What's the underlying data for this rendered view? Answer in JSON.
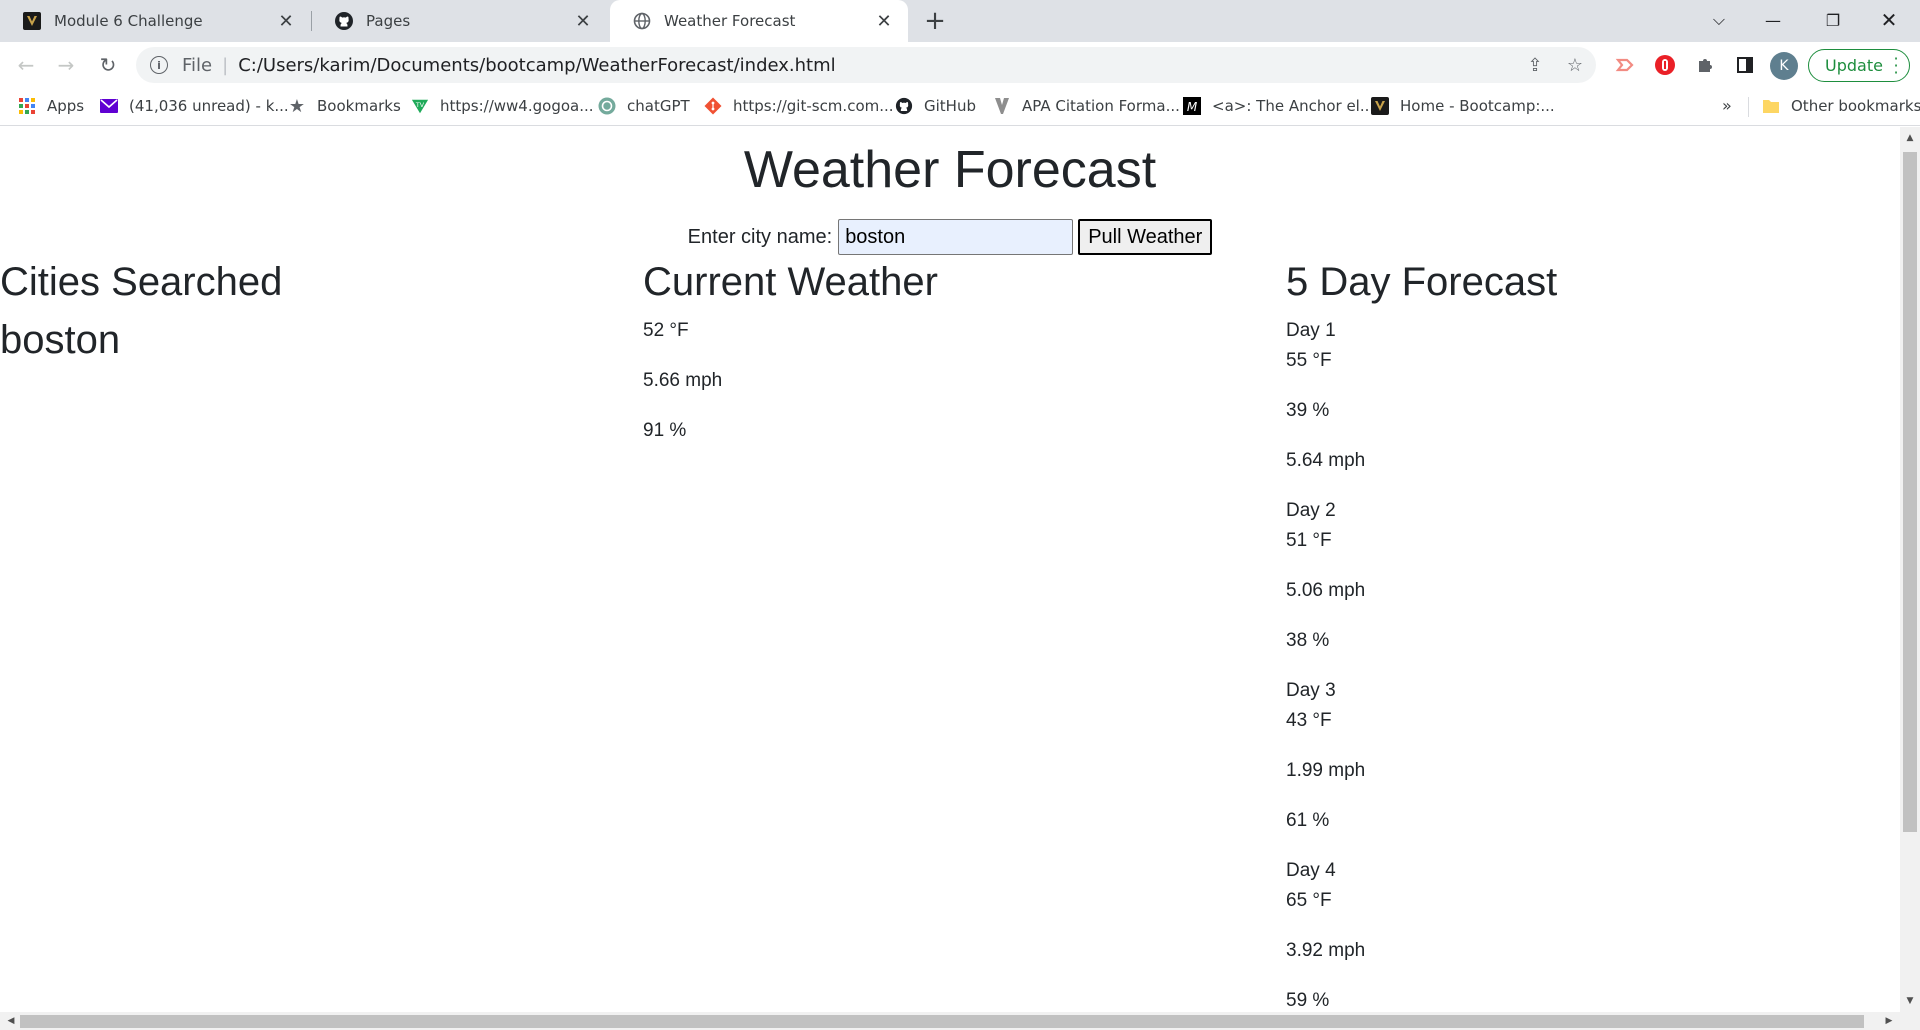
{
  "browser": {
    "tabs": [
      {
        "title": "Module 6 Challenge",
        "icon": "vanderbilt-icon"
      },
      {
        "title": "Pages",
        "icon": "github-icon"
      },
      {
        "title": "Weather Forecast",
        "icon": "globe-icon",
        "active": true
      }
    ],
    "address": {
      "scheme": "File",
      "url": "C:/Users/karim/Documents/bootcamp/WeatherForecast/index.html"
    },
    "avatar_initial": "K",
    "update_label": "Update",
    "bookmarks": [
      {
        "label": "Apps",
        "icon": "apps-grid-icon"
      },
      {
        "label": "(41,036 unread) - k...",
        "icon": "mail-icon"
      },
      {
        "label": "Bookmarks",
        "icon": "star-icon"
      },
      {
        "label": "https://ww4.gogoa...",
        "icon": "gogoanime-icon"
      },
      {
        "label": "chatGPT",
        "icon": "openai-icon"
      },
      {
        "label": "https://git-scm.com...",
        "icon": "git-icon"
      },
      {
        "label": "GitHub",
        "icon": "github-icon"
      },
      {
        "label": "APA Citation Forma...",
        "icon": "purdue-icon"
      },
      {
        "label": "<a>: The Anchor el...",
        "icon": "mdn-icon"
      },
      {
        "label": "Home - Bootcamp:...",
        "icon": "vanderbilt-icon"
      }
    ],
    "more_label": "»",
    "other_bookmarks": "Other bookmarks"
  },
  "page": {
    "title": "Weather Forecast",
    "search": {
      "label": "Enter city name:",
      "value": "boston",
      "button": "Pull Weather"
    },
    "cities": {
      "heading": "Cities Searched",
      "items": [
        "boston"
      ]
    },
    "current": {
      "heading": "Current Weather",
      "temp": "52 °F",
      "wind": "5.66 mph",
      "humidity": "91 %"
    },
    "forecast": {
      "heading": "5 Day Forecast",
      "days": [
        {
          "name": "Day 1",
          "temp": "55 °F",
          "line2": "39 %",
          "line3": "5.64 mph"
        },
        {
          "name": "Day 2",
          "temp": "51 °F",
          "line2": "5.06 mph",
          "line3": "38 %"
        },
        {
          "name": "Day 3",
          "temp": "43 °F",
          "line2": "1.99 mph",
          "line3": "61 %"
        },
        {
          "name": "Day 4",
          "temp": "65 °F",
          "line2": "3.92 mph",
          "line3": "59 %"
        }
      ]
    }
  }
}
